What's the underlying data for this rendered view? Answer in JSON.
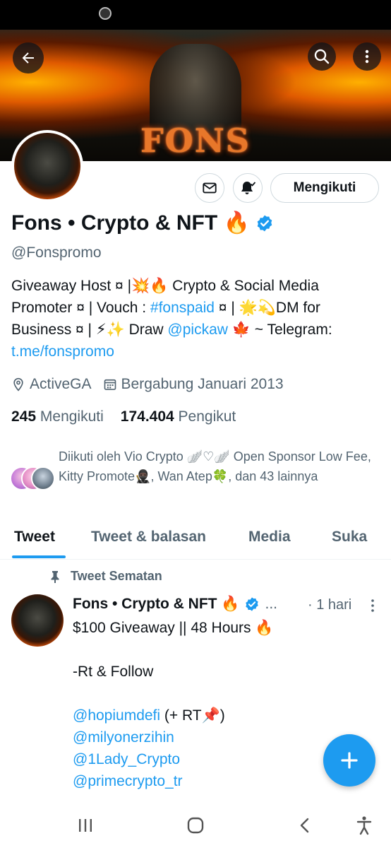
{
  "banner": {
    "title": "FONS"
  },
  "actions": {
    "follow_label": "Mengikuti"
  },
  "profile": {
    "display_name": "Fons • Crypto & NFT 🔥",
    "handle": "@Fonspromo",
    "bio": {
      "p1": "Giveaway Host ¤ |💥🔥 Crypto & Social Media Promoter ¤ | Vouch : ",
      "tag": "#fonspaid",
      "p2": " ¤ | 🌟💫DM for Business ¤ | ⚡✨ Draw ",
      "mention": "@pickaw",
      "p3": " 🍁 ~ Telegram: ",
      "url": "t.me/fonspromo"
    },
    "location": "ActiveGA",
    "joined": "Bergabung Januari 2013",
    "following_count": "245",
    "following_label": "Mengikuti",
    "followers_count": "174.404",
    "followers_label": "Pengikut",
    "followed_by": "Diikuti oleh Vio Crypto 🪽♡🪽 Open Sponsor Low Fee, Kitty Promote🥷🏿, Wan Atep🍀, dan 43 lainnya"
  },
  "tabs": [
    {
      "label": "Tweet"
    },
    {
      "label": "Tweet & balasan"
    },
    {
      "label": "Media"
    },
    {
      "label": "Suka"
    }
  ],
  "pinned": {
    "label": "Tweet Sematan",
    "author": "Fons • Crypto & NFT 🔥",
    "ellipsis": "...",
    "time": "· 1 hari",
    "lines": [
      "$100 Giveaway || 48 Hours 🔥",
      "-Rt & Follow",
      "@hopiumdefi",
      " (+ RT📌)",
      "@milyonerzihin",
      "@1Lady_Crypto",
      "@primecrypto_tr"
    ]
  },
  "colors": {
    "accent": "#1d9bf0",
    "text": "#0f1419",
    "muted": "#536471"
  },
  "icons": [
    "back-arrow-icon",
    "search-icon",
    "more-vertical-icon",
    "mail-icon",
    "bell-icon",
    "verified-badge-icon",
    "location-icon",
    "calendar-icon",
    "pin-icon",
    "plus-icon",
    "recents-icon",
    "home-icon",
    "back-icon",
    "accessibility-icon"
  ]
}
